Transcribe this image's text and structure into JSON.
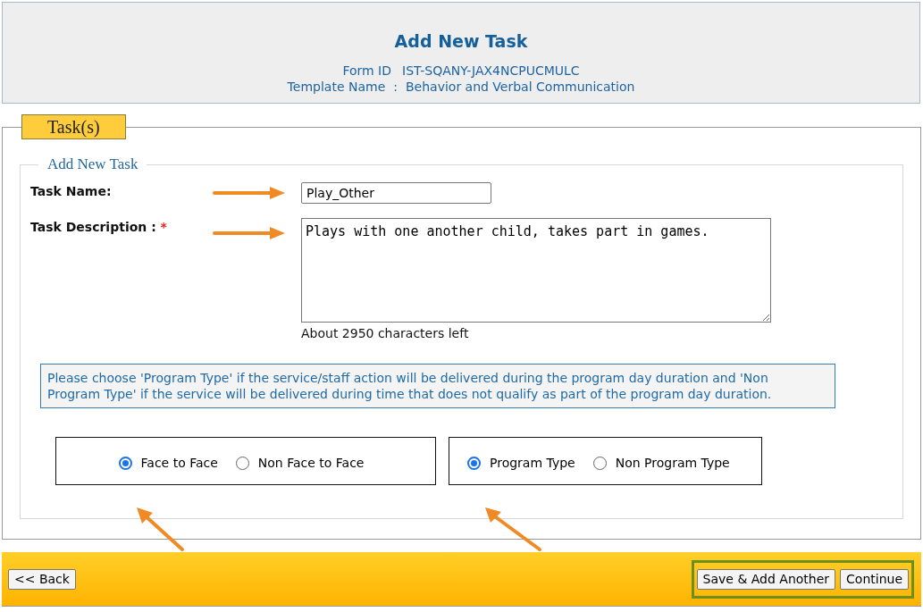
{
  "header": {
    "title": "Add New Task",
    "fields": [
      {
        "label": "Form ID",
        "value": "IST-SQANY-JAX4NCPUCMULC"
      },
      {
        "label": "Template Name",
        "separator": ":",
        "value": "Behavior and Verbal Communication"
      }
    ]
  },
  "panel": {
    "legend": "Task(s)",
    "section_legend": "Add New Task",
    "task_name": {
      "label": "Task Name:",
      "value": "Play_Other"
    },
    "task_description": {
      "label": "Task Description :",
      "required_mark": "*",
      "value": "Plays with one another child, takes part in games.",
      "counter": "About 2950 characters left"
    },
    "info": "Please choose 'Program Type' if the service/staff action will be delivered during the program day duration and 'Non Program Type' if the service will be delivered during time that does not qualify as part of the program day duration.",
    "radio_groups": [
      {
        "options": [
          {
            "label": "Face to Face",
            "selected": true
          },
          {
            "label": "Non Face to Face",
            "selected": false
          }
        ]
      },
      {
        "options": [
          {
            "label": "Program Type",
            "selected": true
          },
          {
            "label": "Non Program Type",
            "selected": false
          }
        ]
      }
    ]
  },
  "footer": {
    "back": "<< Back",
    "buttons": [
      "Save & Add Another",
      "Continue"
    ]
  }
}
